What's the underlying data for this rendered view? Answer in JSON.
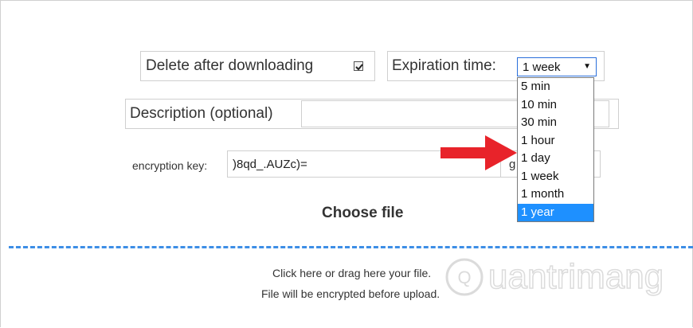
{
  "options": {
    "delete_after_downloading_label": "Delete after downloading",
    "delete_after_downloading_checked": true,
    "expiration_time_label": "Expiration time:",
    "expiration_selected": "1 week",
    "expiration_options": [
      "5 min",
      "10 min",
      "30 min",
      "1 hour",
      "1 day",
      "1 week",
      "1 month",
      "1 year"
    ],
    "expiration_highlighted": "1 year"
  },
  "description": {
    "label": "Description (optional)",
    "value": ""
  },
  "encryption": {
    "label": "encryption key:",
    "value": ")8qd_.AUZc)=",
    "generate_partial": "g"
  },
  "upload": {
    "choose_file": "Choose file",
    "drop_line1": "Click here or drag here your file.",
    "drop_line2": "File will be encrypted before upload."
  },
  "watermark": {
    "text": "uantrimang"
  },
  "colors": {
    "accent_blue": "#1e90ff",
    "dash_blue": "#3d8ee6",
    "arrow_red": "#e8232a"
  }
}
